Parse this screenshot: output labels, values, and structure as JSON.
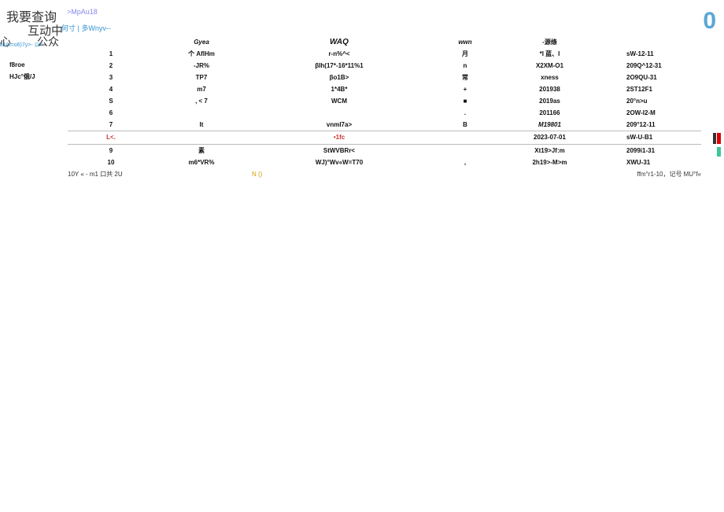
{
  "header": {
    "brand": "我要查询",
    "sub1": "互动中",
    "sub2": "心",
    "gongzhong": "公众",
    "breadcrumb": ">MpAu18",
    "big_zero": "0",
    "controls": "何寸 | 多Wnyv--",
    "small_header": "b1(x=o6)7y>-\n 以<"
  },
  "sidebar": {
    "items": [
      "f8roe",
      "HJc°俄/J"
    ]
  },
  "table": {
    "headers": [
      "",
      "Gyea",
      "WAQ",
      "wwn",
      "-源绦",
      ""
    ],
    "rows": [
      [
        "1",
        "个 AflHm",
        "r-n%^<",
        "月",
        "*I 蓝、I",
        "sW-12-11"
      ],
      [
        "2",
        "-JR%",
        "βIh(17*-16*11%1",
        "n",
        "X2XM-O1",
        "209Q^12-31"
      ],
      [
        "3",
        "TP7",
        "βo1B>",
        "常",
        "xness",
        "2O9QU-31"
      ],
      [
        "4",
        "m7",
        "1*4B*",
        "+",
        "201938",
        "2ST12F1"
      ],
      [
        "S",
        ", < 7",
        "WCM",
        "■",
        "2019as",
        "20°n>u"
      ],
      [
        "6",
        "",
        "",
        ".",
        "201166",
        "2OW-I2-M"
      ],
      [
        "7",
        "It",
        "vnml7a>",
        "B",
        "M19801",
        "209°12-11"
      ],
      [
        "L<.",
        "",
        "•1fc",
        "",
        "2023-07-01",
        "sW-U-B1"
      ],
      [
        "9",
        "素",
        "StWVBRr<",
        "",
        "Xt19>Jf:m",
        "2099i1-31"
      ],
      [
        "10",
        "m6*VR%",
        "WJ)°Wv«W=T70",
        ",",
        "2h19>-M>m",
        "XWU-31"
      ]
    ],
    "footer": {
      "left": "10Y    «    -    m1 口共 2U",
      "nav": "N   ()",
      "right": "ffm°r1-10，记号 MU°f«"
    }
  }
}
